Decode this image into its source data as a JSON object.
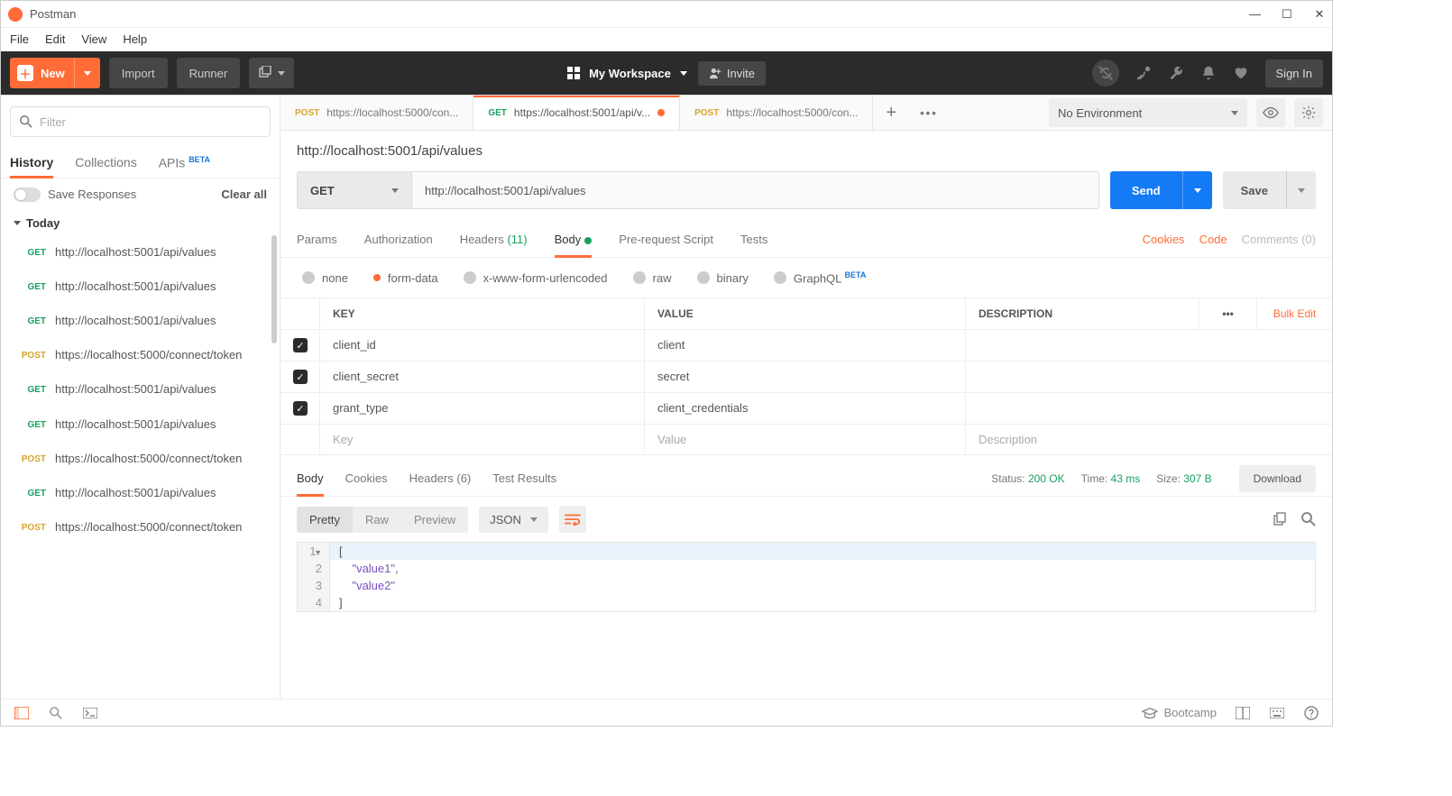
{
  "window": {
    "title": "Postman"
  },
  "menubar": [
    "File",
    "Edit",
    "View",
    "Help"
  ],
  "toolbar": {
    "new_label": "New",
    "import_label": "Import",
    "runner_label": "Runner",
    "workspace_label": "My Workspace",
    "invite_label": "Invite",
    "signin_label": "Sign In"
  },
  "sidebar": {
    "filter_placeholder": "Filter",
    "tabs": {
      "history": "History",
      "collections": "Collections",
      "apis": "APIs",
      "apis_badge": "BETA"
    },
    "save_responses": "Save Responses",
    "clear_all": "Clear all",
    "group": "Today",
    "items": [
      {
        "method": "GET",
        "url": "http://localhost:5001/api/values"
      },
      {
        "method": "GET",
        "url": "http://localhost:5001/api/values"
      },
      {
        "method": "GET",
        "url": "http://localhost:5001/api/values"
      },
      {
        "method": "POST",
        "url": "https://localhost:5000/connect/token"
      },
      {
        "method": "GET",
        "url": "http://localhost:5001/api/values"
      },
      {
        "method": "GET",
        "url": "http://localhost:5001/api/values"
      },
      {
        "method": "POST",
        "url": "https://localhost:5000/connect/token"
      },
      {
        "method": "GET",
        "url": "http://localhost:5001/api/values"
      },
      {
        "method": "POST",
        "url": "https://localhost:5000/connect/token"
      }
    ]
  },
  "tabs": [
    {
      "method": "POST",
      "label": "https://localhost:5000/con...",
      "active": false,
      "dirty": false
    },
    {
      "method": "GET",
      "label": "https://localhost:5001/api/v...",
      "active": true,
      "dirty": true
    },
    {
      "method": "POST",
      "label": "https://localhost:5000/con...",
      "active": false,
      "dirty": false
    }
  ],
  "env": {
    "selected": "No Environment"
  },
  "request": {
    "title": "http://localhost:5001/api/values",
    "method": "GET",
    "url": "http://localhost:5001/api/values",
    "send": "Send",
    "save": "Save",
    "tabs": {
      "params": "Params",
      "auth": "Authorization",
      "headers": "Headers",
      "headers_count": "(11)",
      "body": "Body",
      "prereq": "Pre-request Script",
      "tests": "Tests"
    },
    "links": {
      "cookies": "Cookies",
      "code": "Code",
      "comments": "Comments (0)"
    },
    "body_types": {
      "none": "none",
      "formdata": "form-data",
      "xwww": "x-www-form-urlencoded",
      "raw": "raw",
      "binary": "binary",
      "graphql": "GraphQL",
      "graphql_badge": "BETA"
    },
    "kv": {
      "head": {
        "key": "KEY",
        "value": "VALUE",
        "desc": "DESCRIPTION",
        "bulk": "Bulk Edit"
      },
      "rows": [
        {
          "key": "client_id",
          "value": "client",
          "desc": ""
        },
        {
          "key": "client_secret",
          "value": "secret",
          "desc": ""
        },
        {
          "key": "grant_type",
          "value": "client_credentials",
          "desc": ""
        }
      ],
      "placeholder": {
        "key": "Key",
        "value": "Value",
        "desc": "Description"
      }
    }
  },
  "response": {
    "tabs": {
      "body": "Body",
      "cookies": "Cookies",
      "headers": "Headers",
      "headers_count": "(6)",
      "tests": "Test Results"
    },
    "status_lbl": "Status:",
    "status_val": "200 OK",
    "time_lbl": "Time:",
    "time_val": "43 ms",
    "size_lbl": "Size:",
    "size_val": "307 B",
    "download": "Download",
    "view": {
      "pretty": "Pretty",
      "raw": "Raw",
      "preview": "Preview",
      "lang": "JSON"
    },
    "lines": [
      {
        "n": "1",
        "content_raw": "["
      },
      {
        "n": "2",
        "content_str": "\"value1\"",
        "suffix": ","
      },
      {
        "n": "3",
        "content_str": "\"value2\""
      },
      {
        "n": "4",
        "content_raw": "]"
      }
    ]
  },
  "footer": {
    "bootcamp": "Bootcamp"
  }
}
